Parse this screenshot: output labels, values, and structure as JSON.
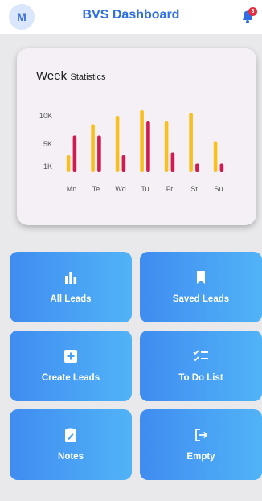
{
  "app": {
    "avatar_initial": "M",
    "title": "BVS Dashboard",
    "notification_count": "3"
  },
  "chart_data": {
    "type": "bar",
    "title_main": "Week",
    "title_sub": "Statistics",
    "categories": [
      "Mn",
      "Te",
      "Wd",
      "Tu",
      "Fr",
      "St",
      "Su"
    ],
    "series": [
      {
        "values": [
          3000,
          8500,
          10000,
          11000,
          9000,
          10500,
          5500
        ],
        "color": "#f7c01f"
      },
      {
        "values": [
          6500,
          6500,
          3000,
          9000,
          3500,
          1500,
          1500
        ],
        "color": "#d21a52"
      }
    ],
    "yticks": [
      "10K",
      "5K",
      "1K"
    ],
    "ytick_values": [
      10000,
      5000,
      1000
    ],
    "ylim": [
      0,
      12000
    ]
  },
  "tiles": [
    {
      "label": "All Leads",
      "icon": "bar-chart-icon"
    },
    {
      "label": "Saved Leads",
      "icon": "bookmark-icon"
    },
    {
      "label": "Create Leads",
      "icon": "add-box-icon"
    },
    {
      "label": "To Do List",
      "icon": "checklist-icon"
    },
    {
      "label": "Notes",
      "icon": "note-edit-icon"
    },
    {
      "label": "Empty",
      "icon": "logout-icon"
    }
  ]
}
